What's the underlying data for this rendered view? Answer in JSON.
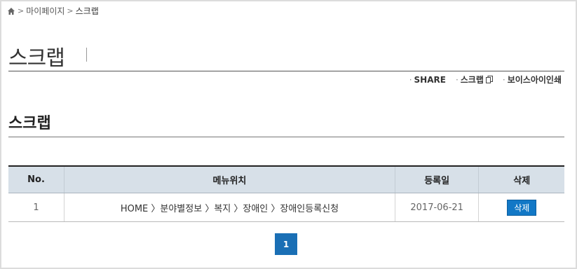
{
  "breadcrumb": {
    "home_icon": "home-icon",
    "items": [
      "마이페이지",
      "스크랩"
    ]
  },
  "page": {
    "title": "스크랩"
  },
  "utility": {
    "share_label": "SHARE",
    "scrap_label": "스크랩",
    "scrap_icon": "copy-icon",
    "voice_label": "보이스아이인쇄"
  },
  "section": {
    "title": "스크랩"
  },
  "table": {
    "headers": [
      "No.",
      "메뉴위치",
      "등록일",
      "삭제"
    ],
    "rows": [
      {
        "no": "1",
        "menu": "HOME 〉분야별정보 〉복지 〉장애인 〉장애인등록신청",
        "date": "2017-06-21",
        "delete_label": "삭제"
      }
    ]
  },
  "pagination": {
    "current": "1"
  },
  "colors": {
    "accent": "#1278c6",
    "pager": "#1a6fb5",
    "header_bg": "#d7e0e8"
  }
}
